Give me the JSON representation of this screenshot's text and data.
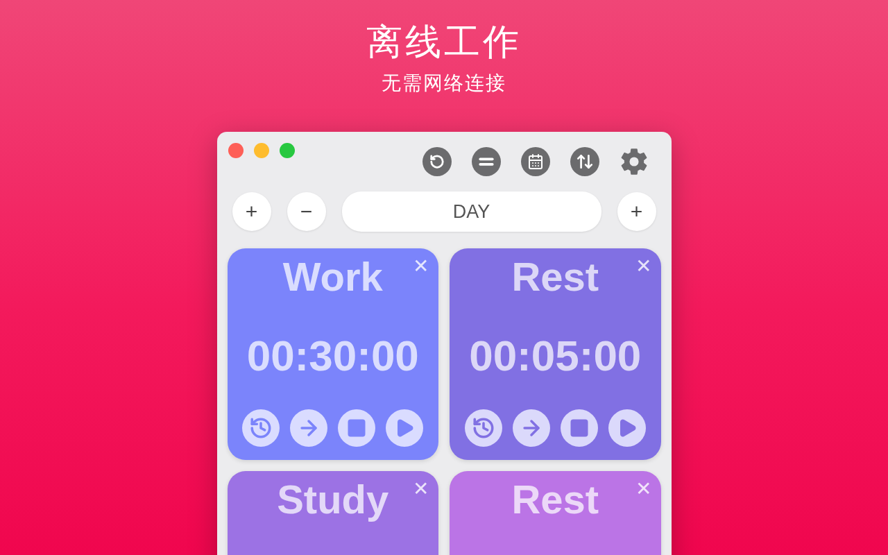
{
  "headline": "离线工作",
  "subtitle": "无需网络连接",
  "window": {
    "toolbar": [
      {
        "kind": "reset"
      },
      {
        "kind": "equal"
      },
      {
        "kind": "calendar"
      },
      {
        "kind": "sort"
      },
      {
        "kind": "settings"
      }
    ],
    "controls": [
      {
        "kind": "add",
        "label": "+"
      },
      {
        "kind": "remove",
        "label": "−"
      },
      {
        "kind": "field",
        "value": "DAY"
      },
      {
        "kind": "add",
        "label": "+"
      }
    ],
    "timers": [
      {
        "title": "Work",
        "close": "✕",
        "time": "00:30:00",
        "color": "#7b84fb"
      },
      {
        "title": "Rest",
        "close": "✕",
        "time": "00:05:00",
        "color": "#8170e3"
      },
      {
        "title": "Study",
        "close": "✕",
        "color": "#9c72e4"
      },
      {
        "title": "Rest",
        "close": "✕",
        "color": "#bb74e6"
      }
    ]
  }
}
